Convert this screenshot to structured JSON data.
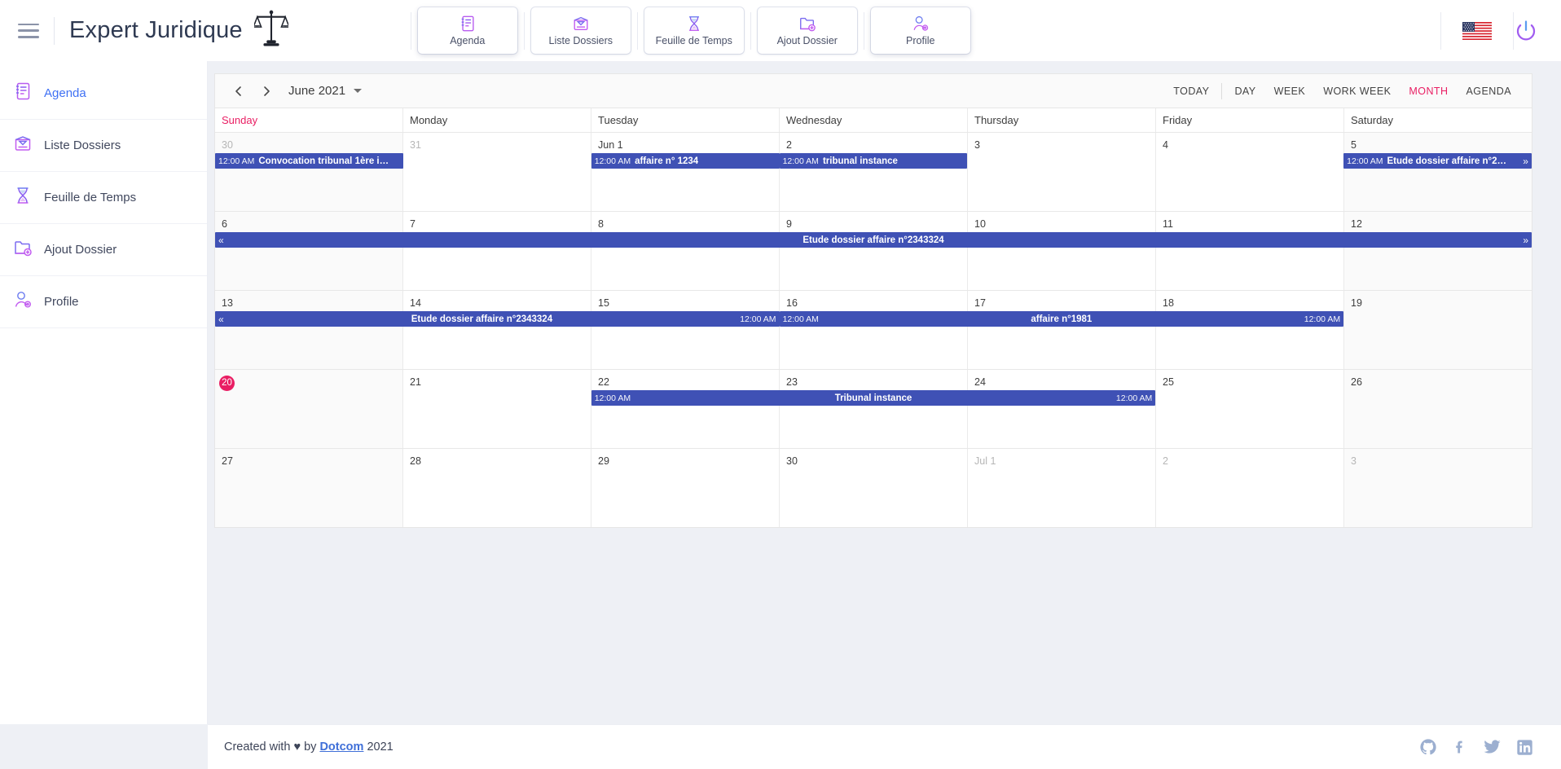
{
  "header": {
    "menu_icon": "hamburger-icon",
    "brand_title": "Expert Juridique",
    "brand_icon": "scales-of-justice-icon",
    "nav": [
      {
        "label": "Agenda",
        "icon": "notebook-icon",
        "active": true
      },
      {
        "label": "Liste Dossiers",
        "icon": "inbox-icon",
        "active": false
      },
      {
        "label": "Feuille de Temps",
        "icon": "hourglass-icon",
        "active": false
      },
      {
        "label": "Ajout Dossier",
        "icon": "folder-plus-icon",
        "active": false
      },
      {
        "label": "Profile",
        "icon": "user-settings-icon",
        "active": true
      }
    ],
    "language_flag": "us-flag-icon",
    "power_icon": "power-button-icon"
  },
  "sidebar": {
    "items": [
      {
        "label": "Agenda",
        "icon": "notebook-icon",
        "active": true
      },
      {
        "label": "Liste Dossiers",
        "icon": "inbox-icon",
        "active": false
      },
      {
        "label": "Feuille de Temps",
        "icon": "hourglass-icon",
        "active": false
      },
      {
        "label": "Ajout Dossier",
        "icon": "folder-plus-icon",
        "active": false
      },
      {
        "label": "Profile",
        "icon": "user-settings-icon",
        "active": false
      }
    ]
  },
  "calendar": {
    "prev_icon": "chevron-left-icon",
    "next_icon": "chevron-right-icon",
    "title": "June 2021",
    "dropdown_icon": "caret-down-icon",
    "views": [
      {
        "label": "TODAY",
        "active": false
      },
      {
        "label": "DAY",
        "active": false
      },
      {
        "label": "WEEK",
        "active": false
      },
      {
        "label": "WORK WEEK",
        "active": false
      },
      {
        "label": "MONTH",
        "active": true
      },
      {
        "label": "AGENDA",
        "active": false
      }
    ],
    "weekdays": [
      {
        "label": "Sunday",
        "weekend": true
      },
      {
        "label": "Monday",
        "weekend": false
      },
      {
        "label": "Tuesday",
        "weekend": false
      },
      {
        "label": "Wednesday",
        "weekend": false
      },
      {
        "label": "Thursday",
        "weekend": false
      },
      {
        "label": "Friday",
        "weekend": false
      },
      {
        "label": "Saturday",
        "weekend": false
      }
    ],
    "accent_event_color": "#3f51b5",
    "today_color": "#e91e63",
    "weeks": [
      {
        "days": [
          {
            "num": "30",
            "other": true,
            "today": false,
            "shaded": true
          },
          {
            "num": "31",
            "other": true,
            "today": false,
            "shaded": false
          },
          {
            "num": "Jun 1",
            "other": false,
            "today": false,
            "shaded": false
          },
          {
            "num": "2",
            "other": false,
            "today": false,
            "shaded": false
          },
          {
            "num": "3",
            "other": false,
            "today": false,
            "shaded": false
          },
          {
            "num": "4",
            "other": false,
            "today": false,
            "shaded": false
          },
          {
            "num": "5",
            "other": false,
            "today": false,
            "shaded": true
          }
        ],
        "events": [
          {
            "start": 0,
            "span": 1,
            "row": 0,
            "time": "12:00 AM",
            "title": "Convocation tribunal 1ère i…",
            "layout": "left",
            "cont_left": false,
            "cont_right": false
          },
          {
            "start": 2,
            "span": 1,
            "row": 0,
            "time": "12:00 AM",
            "title": "affaire n° 1234",
            "layout": "left",
            "cont_left": false,
            "cont_right": false
          },
          {
            "start": 3,
            "span": 1,
            "row": 0,
            "time": "12:00 AM",
            "title": "tribunal instance",
            "layout": "left",
            "cont_left": false,
            "cont_right": false
          },
          {
            "start": 6,
            "span": 1,
            "row": 0,
            "time": "12:00 AM",
            "title": "Etude dossier affaire n°2…",
            "layout": "left",
            "cont_left": false,
            "cont_right": true
          }
        ]
      },
      {
        "days": [
          {
            "num": "6",
            "other": false,
            "today": false,
            "shaded": true
          },
          {
            "num": "7",
            "other": false,
            "today": false,
            "shaded": false
          },
          {
            "num": "8",
            "other": false,
            "today": false,
            "shaded": false
          },
          {
            "num": "9",
            "other": false,
            "today": false,
            "shaded": false
          },
          {
            "num": "10",
            "other": false,
            "today": false,
            "shaded": false
          },
          {
            "num": "11",
            "other": false,
            "today": false,
            "shaded": false
          },
          {
            "num": "12",
            "other": false,
            "today": false,
            "shaded": true
          }
        ],
        "events": [
          {
            "start": 0,
            "span": 7,
            "row": 0,
            "time": "",
            "title": "Etude dossier affaire n°2343324",
            "layout": "center",
            "cont_left": true,
            "cont_right": true
          }
        ]
      },
      {
        "days": [
          {
            "num": "13",
            "other": false,
            "today": false,
            "shaded": true
          },
          {
            "num": "14",
            "other": false,
            "today": false,
            "shaded": false
          },
          {
            "num": "15",
            "other": false,
            "today": false,
            "shaded": false
          },
          {
            "num": "16",
            "other": false,
            "today": false,
            "shaded": false
          },
          {
            "num": "17",
            "other": false,
            "today": false,
            "shaded": false
          },
          {
            "num": "18",
            "other": false,
            "today": false,
            "shaded": false
          },
          {
            "num": "19",
            "other": false,
            "today": false,
            "shaded": true
          }
        ],
        "events": [
          {
            "start": 0,
            "span": 3,
            "row": 0,
            "time": "",
            "title": "Etude dossier affaire n°2343324",
            "end_time": "12:00 AM",
            "layout": "center",
            "cont_left": true,
            "cont_right": false
          },
          {
            "start": 3,
            "span": 3,
            "row": 0,
            "time": "12:00 AM",
            "title": "affaire n°1981",
            "end_time": "12:00 AM",
            "layout": "center",
            "cont_left": false,
            "cont_right": false
          }
        ]
      },
      {
        "days": [
          {
            "num": "20",
            "other": false,
            "today": true,
            "shaded": true
          },
          {
            "num": "21",
            "other": false,
            "today": false,
            "shaded": false
          },
          {
            "num": "22",
            "other": false,
            "today": false,
            "shaded": false
          },
          {
            "num": "23",
            "other": false,
            "today": false,
            "shaded": false
          },
          {
            "num": "24",
            "other": false,
            "today": false,
            "shaded": false
          },
          {
            "num": "25",
            "other": false,
            "today": false,
            "shaded": false
          },
          {
            "num": "26",
            "other": false,
            "today": false,
            "shaded": true
          }
        ],
        "events": [
          {
            "start": 2,
            "span": 3,
            "row": 0,
            "time": "12:00 AM",
            "title": "Tribunal instance",
            "end_time": "12:00 AM",
            "layout": "center",
            "cont_left": false,
            "cont_right": false
          }
        ]
      },
      {
        "days": [
          {
            "num": "27",
            "other": false,
            "today": false,
            "shaded": true
          },
          {
            "num": "28",
            "other": false,
            "today": false,
            "shaded": false
          },
          {
            "num": "29",
            "other": false,
            "today": false,
            "shaded": false
          },
          {
            "num": "30",
            "other": false,
            "today": false,
            "shaded": false
          },
          {
            "num": "Jul 1",
            "other": true,
            "today": false,
            "shaded": false
          },
          {
            "num": "2",
            "other": true,
            "today": false,
            "shaded": false
          },
          {
            "num": "3",
            "other": true,
            "today": false,
            "shaded": true
          }
        ],
        "events": []
      }
    ]
  },
  "footer": {
    "prefix": "Created with",
    "heart": "♥",
    "by": "by",
    "link": "Dotcom",
    "year": "2021",
    "socials": [
      "github-icon",
      "facebook-icon",
      "twitter-icon",
      "linkedin-icon"
    ]
  }
}
